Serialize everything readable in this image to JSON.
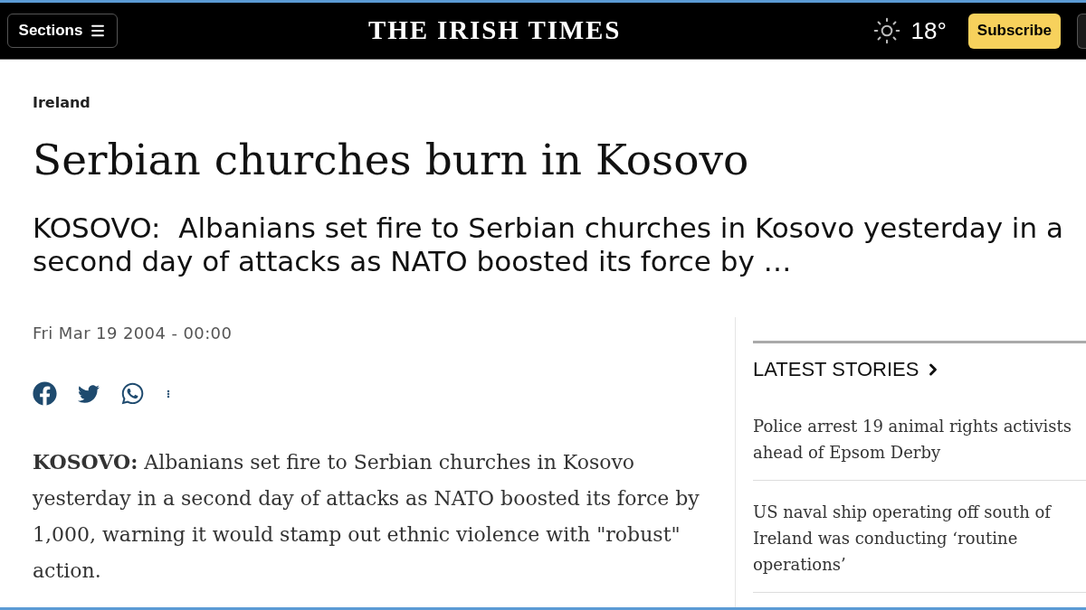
{
  "header": {
    "sections_button": {
      "label": "Sections"
    },
    "masthead": "THE IRISH TIMES",
    "weather": {
      "temperature": "18°"
    },
    "subscribe_button": {
      "label": "Subscribe"
    }
  },
  "article": {
    "section": "Ireland",
    "headline": "Serbian churches burn in Kosovo",
    "standfirst": "KOSOVO:  Albanians set fire to Serbian churches in Kosovo yesterday in a second day of attacks as NATO boosted its force by …",
    "date": "Fri Mar 19 2004 - 00:00",
    "body": "**KOSOVO:** Albanians set fire to Serbian churches in Kosovo yesterday in a second day of attacks as NATO boosted its force by 1,000, warning it would stamp out ethnic violence with \"robust\" action."
  },
  "sidebar": {
    "title": "LATEST STORIES",
    "stories": [
      "Police arrest 19 animal rights activists ahead of Epsom Derby",
      "US naval ship operating off south of Ireland was conducting ‘routine operations’"
    ]
  }
}
